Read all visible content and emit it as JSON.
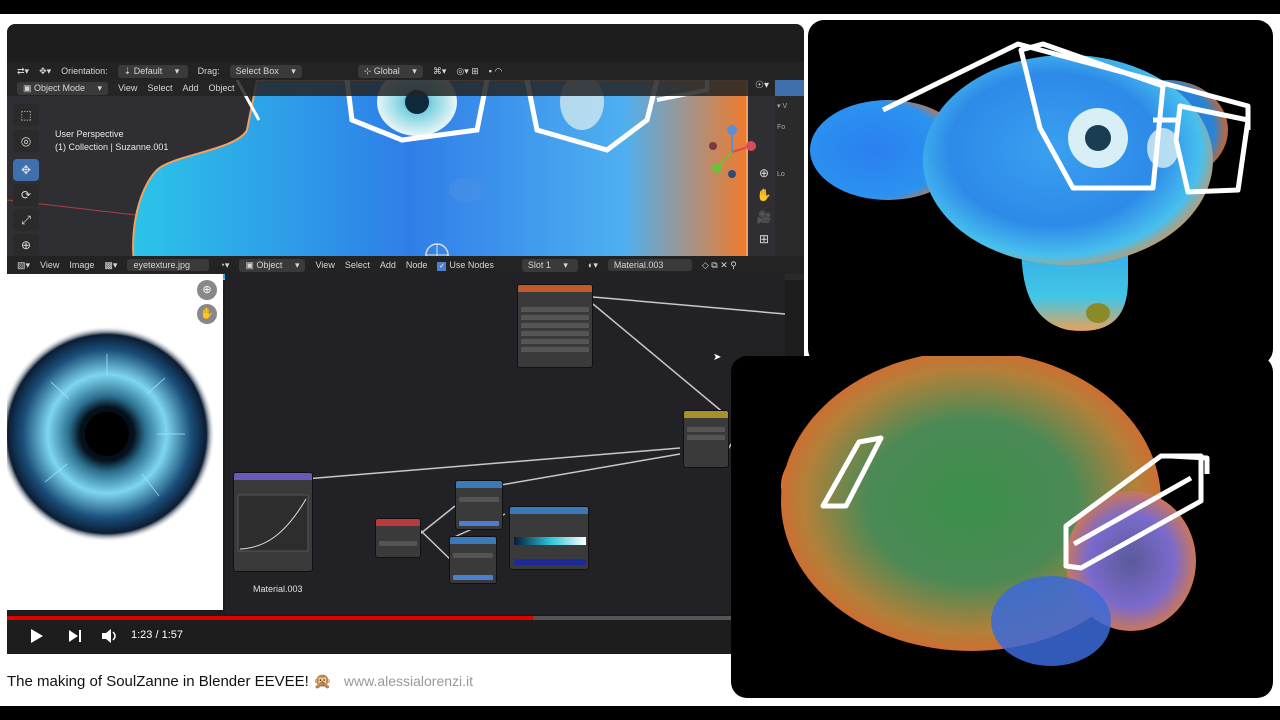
{
  "video": {
    "title": "The making of SoulZanne in Blender EEVEE!",
    "emoji": "🙊",
    "url": "www.alessialorenzi.it",
    "time_current": "1:23",
    "time_total": "1:57",
    "time_separator": "/",
    "progress": 0.725
  },
  "blender": {
    "top_header": {
      "orientation_label": "Orientation:",
      "orientation_value": "Default",
      "drag_label": "Drag:",
      "drag_value": "Select Box",
      "transform_value": "Global"
    },
    "viewport_header": {
      "mode": "Object Mode",
      "menu": [
        "View",
        "Select",
        "Add",
        "Object"
      ]
    },
    "viewport_overlay": {
      "line1": "User Perspective",
      "line2": "(1) Collection | Suzanne.001"
    },
    "image_editor": {
      "menu": [
        "View",
        "Image"
      ],
      "image_name": "eyetexture.jpg"
    },
    "node_editor": {
      "object_value": "Object",
      "menu": [
        "View",
        "Select",
        "Add",
        "Node"
      ],
      "use_nodes_label": "Use Nodes",
      "use_nodes": true,
      "slot_value": "Slot 1",
      "material_value": "Material.003",
      "material_label": "Material.003"
    }
  },
  "colors": {
    "blender_bg": "#1d1d1d",
    "active_tool": "#3f6fad",
    "progress_red": "#e00000",
    "suzanne_blue": "#2f8ef0",
    "rim_orange": "#f07a2c"
  }
}
